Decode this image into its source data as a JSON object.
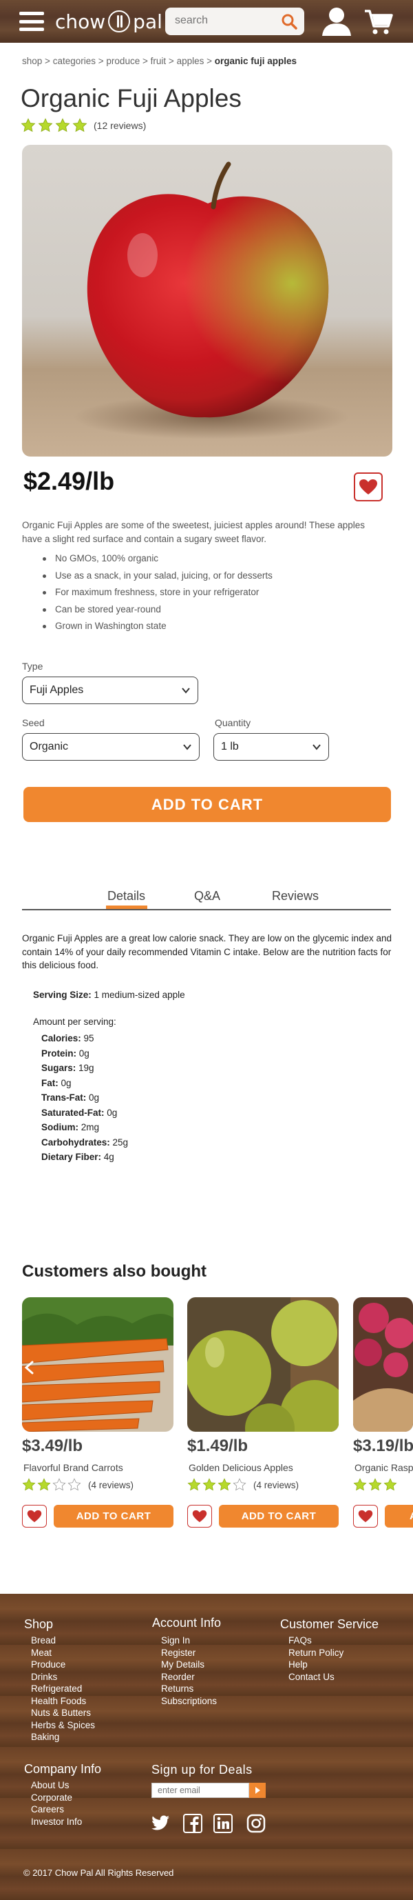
{
  "header": {
    "logo_left": "chow",
    "logo_right": "pal",
    "search_placeholder": "search"
  },
  "breadcrumb": {
    "items": [
      "shop",
      "categories",
      "produce",
      "fruit",
      "apples"
    ],
    "separator": ">",
    "current": "organic fuji apples"
  },
  "product": {
    "title": "Organic Fuji Apples",
    "rating": 4,
    "reviews_label": "(12 reviews)",
    "price": "$2.49/lb",
    "description": "Organic Fuji Apples are some of the sweetest, juiciest apples around!  These apples have a slight red surface and contain a sugary sweet flavor.",
    "bullets": [
      "No GMOs, 100% organic",
      "Use as a snack, in your salad, juicing, or for desserts",
      "For maximum freshness, store in your refrigerator",
      "Can be stored year-round",
      "Grown in Washington state"
    ],
    "type_label": "Type",
    "type_value": "Fuji Apples",
    "seed_label": "Seed",
    "seed_value": "Organic",
    "quantity_label": "Quantity",
    "quantity_value": "1 lb",
    "add_to_cart": "ADD TO CART"
  },
  "tabs": [
    {
      "label": "Details",
      "active": true
    },
    {
      "label": "Q&A",
      "active": false
    },
    {
      "label": "Reviews",
      "active": false
    }
  ],
  "details": {
    "text": "Organic Fuji Apples are a great low calorie snack.  They are low on the glycemic index and contain 14% of your daily recommended Vitamin C intake.  Below are the nutrition facts for this delicious food.",
    "serving_label": "Serving Size:",
    "serving_value": "1 medium-sized apple",
    "amount_label": "Amount per serving:",
    "nutrients": [
      {
        "name": "Calories:",
        "value": " 95"
      },
      {
        "name": "Protein:",
        "value": " 0g"
      },
      {
        "name": "Sugars:",
        "value": " 19g"
      },
      {
        "name": "Fat:",
        "value": " 0g"
      },
      {
        "name": "Trans-Fat:",
        "value": " 0g"
      },
      {
        "name": "Saturated-Fat:",
        "value": " 0g"
      },
      {
        "name": "Sodium:",
        "value": " 2mg"
      },
      {
        "name": "Carbohydrates:",
        "value": " 25g"
      },
      {
        "name": "Dietary Fiber:",
        "value": " 4g"
      }
    ]
  },
  "also_bought": {
    "title": "Customers also bought",
    "items": [
      {
        "price": "$3.49/lb",
        "name": "Flavorful Brand Carrots",
        "rating": 2,
        "reviews": "(4 reviews)",
        "add": "ADD TO CART"
      },
      {
        "price": "$1.49/lb",
        "name": "Golden Delicious Apples",
        "rating": 3,
        "reviews": "(4 reviews)",
        "add": "ADD TO CART"
      },
      {
        "price": "$3.19/lb",
        "name": "Organic Rasp",
        "rating": 3,
        "reviews": "",
        "add": "A"
      }
    ]
  },
  "footer": {
    "shop_title": "Shop",
    "shop_links": [
      "Bread",
      "Meat",
      "Produce",
      "Drinks",
      "Refrigerated",
      "Health Foods",
      "Nuts & Butters",
      "Herbs & Spices",
      "Baking"
    ],
    "account_title": "Account Info",
    "account_links": [
      "Sign In",
      "Register",
      "My Details",
      "Reorder",
      "Returns",
      "Subscriptions"
    ],
    "service_title": "Customer Service",
    "service_links": [
      "FAQs",
      "Return Policy",
      "Help",
      "Contact Us"
    ],
    "company_title": "Company Info",
    "company_links": [
      "About Us",
      "Corporate",
      "Careers",
      "Investor Info"
    ],
    "deals_title": "Sign up for Deals",
    "email_placeholder": "enter email",
    "copyright": "© 2017 Chow Pal   All Rights Reserved"
  },
  "colors": {
    "accent": "#f0872f",
    "heart": "#c9302c",
    "star": "#b6d92c",
    "header_wood": "#5e3c29"
  },
  "icons": [
    "hamburger-icon",
    "search-icon",
    "account-icon",
    "cart-icon",
    "heart-icon",
    "star-icon",
    "chevron-down-icon",
    "chevron-left-icon",
    "twitter-icon",
    "facebook-icon",
    "linkedin-icon",
    "instagram-icon"
  ]
}
